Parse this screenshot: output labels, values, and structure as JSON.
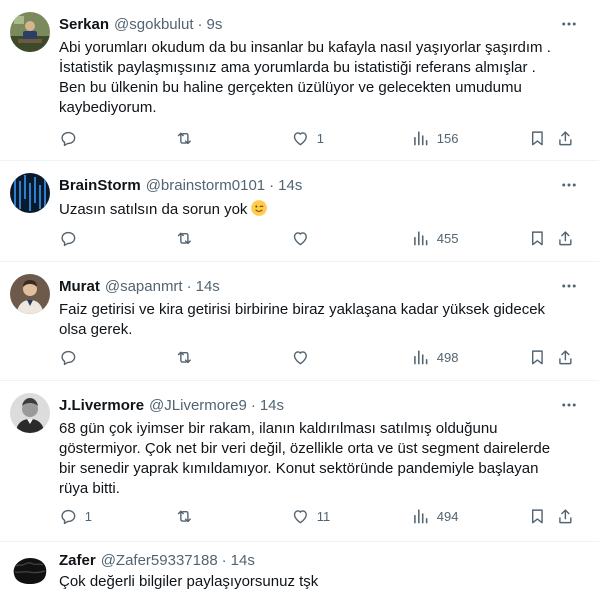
{
  "tweets": [
    {
      "name": "Serkan",
      "handle": "@sgokbulut",
      "time": "9s",
      "avatar_icon": "person-at-desk-avatar",
      "lines": [
        "Abi yorumları okudum da bu insanlar bu kafayla nasıl yaşıyorlar şaşırdım .",
        "İstatistik paylaşmışsınız ama yorumlarda bu istatistiği referans almışlar .",
        "Ben bu ülkenin bu haline gerçekten üzülüyor ve gelecekten umudumu",
        "kaybediyorum."
      ],
      "replies": "",
      "retweets": "",
      "likes": "1",
      "views": "156"
    },
    {
      "name": "BrainStorm",
      "handle": "@brainstorm0101",
      "time": "14s",
      "avatar_icon": "matrix-code-avatar",
      "lines": [
        "Uzasın satılsın da sorun yok"
      ],
      "emoji": "winking-face-emoji",
      "replies": "",
      "retweets": "",
      "likes": "",
      "views": "455"
    },
    {
      "name": "Murat",
      "handle": "@sapanmrt",
      "time": "14s",
      "avatar_icon": "man-portrait-avatar",
      "lines": [
        "Faiz getirisi ve kira getirisi birbirine biraz yaklaşana kadar yüksek gidecek",
        "olsa gerek."
      ],
      "replies": "",
      "retweets": "",
      "likes": "",
      "views": "498"
    },
    {
      "name": "J.Livermore",
      "handle": "@JLivermore9",
      "time": "14s",
      "avatar_icon": "vintage-portrait-avatar",
      "lines": [
        "68 gün çok iyimser bir rakam, ilanın kaldırılması satılmış olduğunu",
        "göstermiyor. Çok net bir veri değil, özellikle orta ve üst segment dairelerde",
        "bir senedir yaprak kımıldamıyor. Konut sektöründe pandemiyle başlayan",
        "rüya bitti."
      ],
      "replies": "1",
      "retweets": "",
      "likes": "11",
      "views": "494"
    },
    {
      "name": "Zafer",
      "handle": "@Zafer59337188",
      "time": "14s",
      "avatar_icon": "hair-silhouette-avatar",
      "lines": [
        "Çok değerli bilgiler paylaşıyorsunuz tşk"
      ],
      "replies": "",
      "retweets": "",
      "likes": "",
      "views": ""
    }
  ],
  "colors": {
    "text": "#0f1419",
    "secondary": "#536471",
    "divider": "#eff3f4"
  },
  "icons": {
    "reply": "reply-icon",
    "retweet": "retweet-icon",
    "like": "heart-icon",
    "views": "bar-chart-icon",
    "bookmark": "bookmark-icon",
    "share": "share-icon",
    "more": "more-icon"
  }
}
